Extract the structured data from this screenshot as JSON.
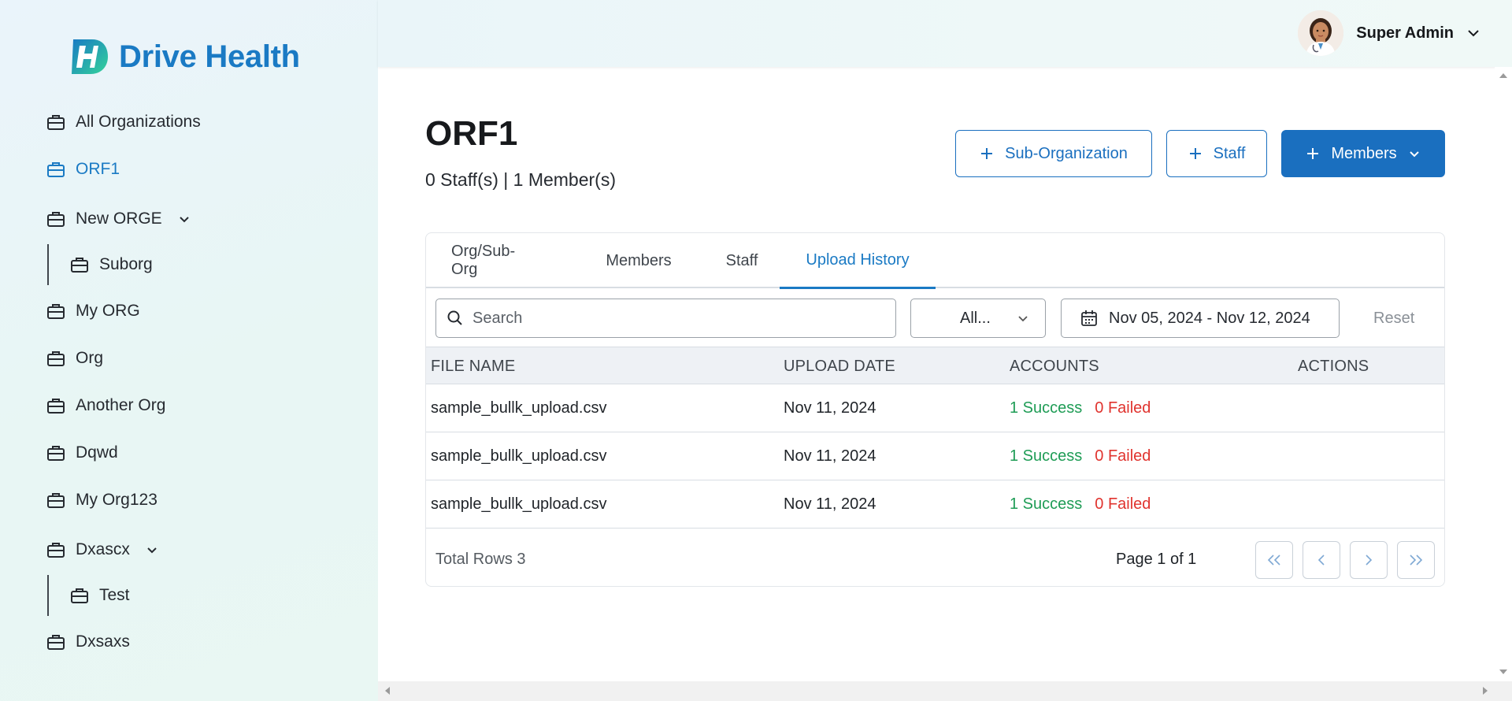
{
  "brand": {
    "name": "Drive Health",
    "accent": "#1a7ac4"
  },
  "header": {
    "user_name": "Super Admin"
  },
  "sidebar": {
    "items": [
      {
        "label": "All Organizations"
      },
      {
        "label": "ORF1",
        "active": true
      },
      {
        "label": "New ORGE",
        "expandable": true
      },
      {
        "label": "Suborg",
        "child": true
      },
      {
        "label": "My ORG"
      },
      {
        "label": "Org"
      },
      {
        "label": "Another Org"
      },
      {
        "label": "Dqwd"
      },
      {
        "label": "My Org123"
      },
      {
        "label": "Dxascx",
        "expandable": true
      },
      {
        "label": "Test",
        "child": true
      },
      {
        "label": "Dxsaxs"
      }
    ]
  },
  "page": {
    "title": "ORF1",
    "subtitle": "0 Staff(s) | 1 Member(s)",
    "buttons": {
      "sub_org": "Sub-Organization",
      "staff": "Staff",
      "members": "Members"
    }
  },
  "tabs": [
    {
      "label": "Org/Sub-Org"
    },
    {
      "label": "Members"
    },
    {
      "label": "Staff"
    },
    {
      "label": "Upload History",
      "active": true
    }
  ],
  "filters": {
    "search_placeholder": "Search",
    "select_value": "All...",
    "date_range": "Nov 05, 2024 - Nov 12, 2024",
    "reset_label": "Reset"
  },
  "table": {
    "columns": [
      "FILE NAME",
      "UPLOAD DATE",
      "ACCOUNTS",
      "ACTIONS"
    ],
    "rows": [
      {
        "file": "sample_bullk_upload.csv",
        "date": "Nov 11, 2024",
        "success": "1 Success",
        "failed": "0 Failed"
      },
      {
        "file": "sample_bullk_upload.csv",
        "date": "Nov 11, 2024",
        "success": "1 Success",
        "failed": "0 Failed"
      },
      {
        "file": "sample_bullk_upload.csv",
        "date": "Nov 11, 2024",
        "success": "1 Success",
        "failed": "0 Failed"
      }
    ]
  },
  "pagination": {
    "total_rows": "Total Rows 3",
    "page_info": "Page 1 of 1"
  }
}
